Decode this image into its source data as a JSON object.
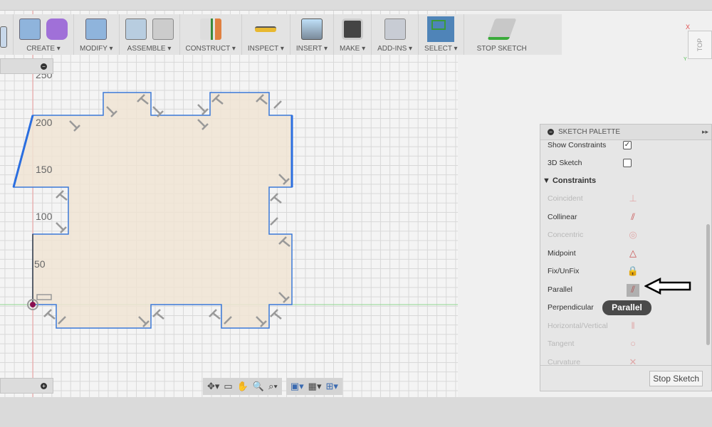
{
  "toolbar": {
    "groups": [
      {
        "label": "CREATE ▾",
        "icon": "create-box-icon"
      },
      {
        "label": "MODIFY ▾",
        "icon": "modify-icon"
      },
      {
        "label": "ASSEMBLE ▾",
        "icon": "assemble-icon"
      },
      {
        "label": "CONSTRUCT ▾",
        "icon": "construct-plane-icon"
      },
      {
        "label": "INSPECT ▾",
        "icon": "measure-icon"
      },
      {
        "label": "INSERT ▾",
        "icon": "insert-image-icon"
      },
      {
        "label": "MAKE ▾",
        "icon": "3d-print-icon"
      },
      {
        "label": "ADD-INS ▾",
        "icon": "scripts-icon"
      },
      {
        "label": "SELECT ▾",
        "icon": "select-icon"
      },
      {
        "label": "STOP SKETCH",
        "icon": "stop-sketch-icon"
      }
    ]
  },
  "viewcube": {
    "face": "TOP",
    "x_axis": "X",
    "y_axis": "Y"
  },
  "axis_labels": [
    "250",
    "200",
    "150",
    "100",
    "50"
  ],
  "palette": {
    "title": "SKETCH PALETTE",
    "options": [
      {
        "label": "Show Constraints",
        "checked": true
      },
      {
        "label": "3D Sketch",
        "checked": false
      }
    ],
    "section": "▼ Constraints",
    "constraints": [
      {
        "label": "Coincident",
        "enabled": false,
        "glyph": "⊥"
      },
      {
        "label": "Collinear",
        "enabled": true,
        "glyph": "⫽"
      },
      {
        "label": "Concentric",
        "enabled": false,
        "glyph": "◎"
      },
      {
        "label": "Midpoint",
        "enabled": true,
        "glyph": "△"
      },
      {
        "label": "Fix/UnFix",
        "enabled": true,
        "glyph": "🔒"
      },
      {
        "label": "Parallel",
        "enabled": true,
        "glyph": "⫽"
      },
      {
        "label": "Perpendicular",
        "enabled": true,
        "glyph": ""
      },
      {
        "label": "Horizontal/Vertical",
        "enabled": false,
        "glyph": "‖"
      },
      {
        "label": "Tangent",
        "enabled": false,
        "glyph": "○"
      },
      {
        "label": "Curvature",
        "enabled": false,
        "glyph": "✕"
      }
    ],
    "stop_button": "Stop Sketch"
  },
  "tooltip": "Parallel",
  "colors": {
    "sketch_line": "#3a78d8",
    "profile_fill": "#f0e4d4",
    "select_active": "#4f84b8"
  }
}
